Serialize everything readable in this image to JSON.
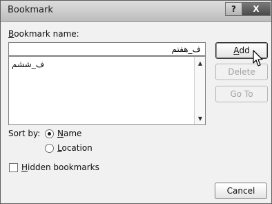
{
  "window": {
    "title": "Bookmark",
    "help_label": "?",
    "close_label": "X"
  },
  "bookmark_name": {
    "label_prefix": "",
    "label_key": "B",
    "label_rest": "ookmark name:",
    "value": "ف_هفتم"
  },
  "bookmark_list": {
    "items": [
      "ف_ششم"
    ]
  },
  "buttons": {
    "add_key": "A",
    "add_rest": "dd",
    "delete": "Delete",
    "goto": "Go To",
    "cancel": "Cancel"
  },
  "sort_by": {
    "label": "Sort by:",
    "name_key": "N",
    "name_rest": "ame",
    "location_key": "L",
    "location_rest": "ocation",
    "selected": "Name"
  },
  "hidden_bookmarks": {
    "key": "H",
    "rest": "idden bookmarks",
    "checked": false
  }
}
